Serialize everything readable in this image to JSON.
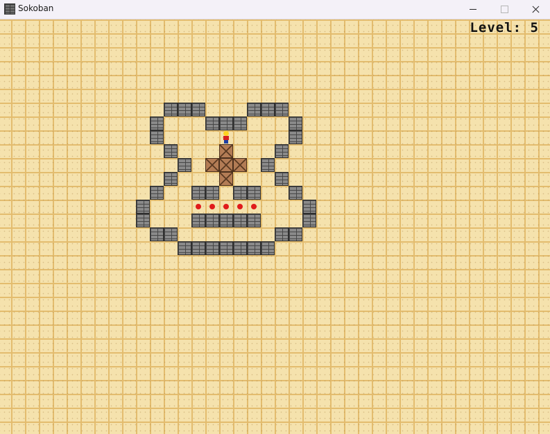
{
  "window": {
    "title": "Sokoban",
    "icon": "brick-wall-icon",
    "controls": [
      "minimize-icon",
      "maximize-icon",
      "close-icon"
    ]
  },
  "game": {
    "level_label": "Level: 5",
    "walls": [
      [
        12,
        6
      ],
      [
        13,
        6
      ],
      [
        14,
        6
      ],
      [
        18,
        6
      ],
      [
        19,
        6
      ],
      [
        20,
        6
      ],
      [
        11,
        7
      ],
      [
        15,
        7
      ],
      [
        16,
        7
      ],
      [
        17,
        7
      ],
      [
        21,
        7
      ],
      [
        11,
        8
      ],
      [
        21,
        8
      ],
      [
        12,
        9
      ],
      [
        20,
        9
      ],
      [
        13,
        10
      ],
      [
        19,
        10
      ],
      [
        12,
        11
      ],
      [
        20,
        11
      ],
      [
        11,
        12
      ],
      [
        14,
        12
      ],
      [
        15,
        12
      ],
      [
        17,
        12
      ],
      [
        18,
        12
      ],
      [
        21,
        12
      ],
      [
        10,
        13
      ],
      [
        22,
        13
      ],
      [
        10,
        14
      ],
      [
        14,
        14
      ],
      [
        15,
        14
      ],
      [
        16,
        14
      ],
      [
        17,
        14
      ],
      [
        18,
        14
      ],
      [
        22,
        14
      ],
      [
        11,
        15
      ],
      [
        12,
        15
      ],
      [
        20,
        15
      ],
      [
        21,
        15
      ],
      [
        13,
        16
      ],
      [
        14,
        16
      ],
      [
        15,
        16
      ],
      [
        16,
        16
      ],
      [
        17,
        16
      ],
      [
        18,
        16
      ],
      [
        19,
        16
      ]
    ],
    "boxes": [
      [
        16,
        9
      ],
      [
        15,
        10
      ],
      [
        16,
        10
      ],
      [
        17,
        10
      ],
      [
        16,
        11
      ]
    ],
    "goals": [
      [
        14,
        13
      ],
      [
        15,
        13
      ],
      [
        16,
        13
      ],
      [
        17,
        13
      ],
      [
        18,
        13
      ]
    ],
    "player": [
      16,
      8
    ]
  }
}
